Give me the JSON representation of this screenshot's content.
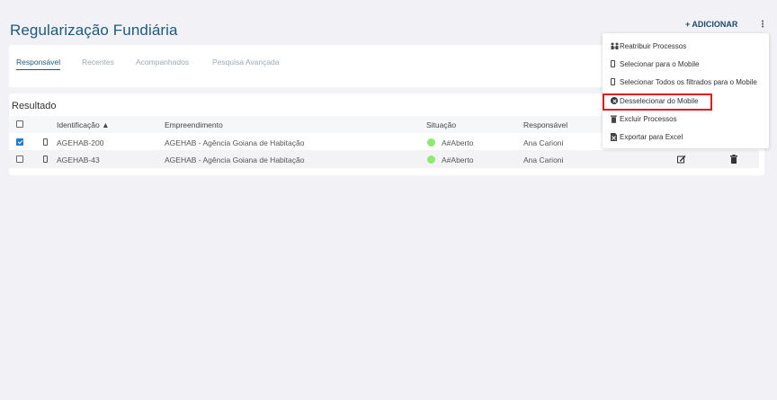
{
  "page": {
    "title": "Regularização Fundiária"
  },
  "header": {
    "add_label": "+ ADICIONAR",
    "more_label": "⋮"
  },
  "tabs": [
    {
      "label": "Responsável",
      "active": true
    },
    {
      "label": "Recentes",
      "active": false
    },
    {
      "label": "Acompanhados",
      "active": false
    },
    {
      "label": "Pesquisa Avançada",
      "active": false
    }
  ],
  "result": {
    "title": "Resultado",
    "columns": [
      "Identificação ▲",
      "Empreendimento",
      "Situação",
      "Responsável"
    ],
    "rows": [
      {
        "checked": true,
        "id": "AGEHAB-200",
        "empreendimento": "AGEHAB - Agência Goiana de Habitação",
        "situacao": "A#Aberto",
        "responsavel": "Ana Carioni",
        "status_color": "#8ee872"
      },
      {
        "checked": false,
        "id": "AGEHAB-43",
        "empreendimento": "AGEHAB - Agência Goiana de Habitação",
        "situacao": "A#Aberto",
        "responsavel": "Ana Carioni",
        "status_color": "#8ee872"
      }
    ]
  },
  "menu": {
    "items": [
      {
        "label": "Reatribuir Processos",
        "icon": "reassign-icon"
      },
      {
        "label": "Selecionar para o Mobile",
        "icon": "mobile-icon"
      },
      {
        "label": "Selecionar Todos os filtrados para o Mobile",
        "icon": "mobile-icon"
      },
      {
        "label": "Desselecionar do Mobile",
        "icon": "x-circle-icon",
        "highlighted": true
      },
      {
        "label": "Excluir Processos",
        "icon": "trash-icon"
      },
      {
        "label": "Exportar para Excel",
        "icon": "file-excel-icon"
      }
    ]
  },
  "colors": {
    "brand": "#1e5a7e",
    "checkbox": "#1f79d6",
    "highlight": "#e01b1b",
    "status_open": "#8ee872"
  }
}
